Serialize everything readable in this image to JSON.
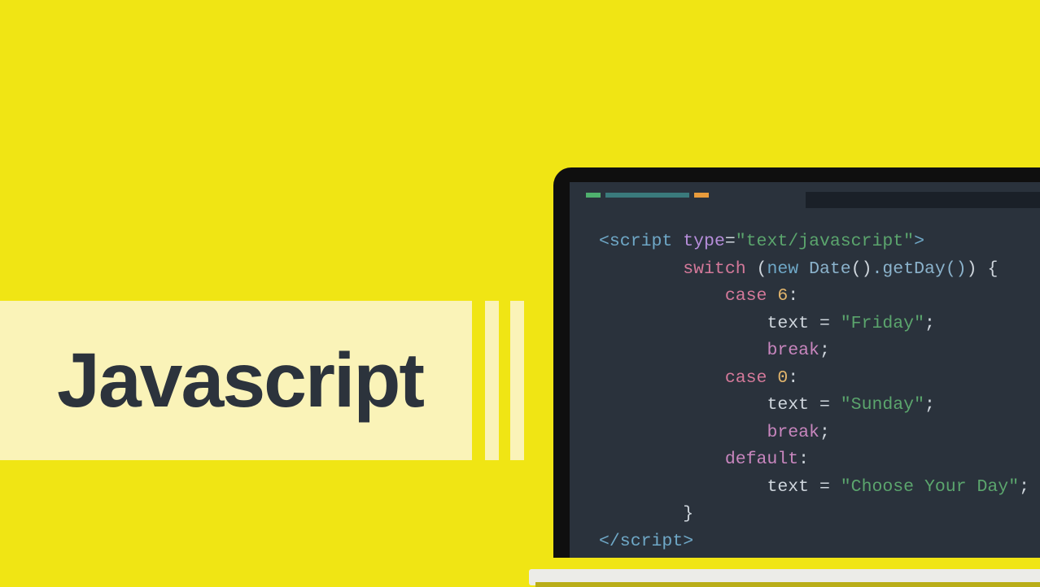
{
  "title": "Javascript",
  "colors": {
    "background": "#f0e514",
    "banner": "#faf3b8",
    "titleText": "#2c333c",
    "screen": "#2a323c",
    "bezel": "#0f0f0f"
  },
  "tabIndicators": [
    {
      "color": "#4fb06e",
      "name": "green"
    },
    {
      "color": "#3a7a7c",
      "name": "teal"
    },
    {
      "color": "#e89b3c",
      "name": "orange"
    }
  ],
  "code": {
    "tagOpen": "<script",
    "attrName": "type",
    "eq": "=",
    "attrValue": "\"text/javascript\"",
    "tagClose": ">",
    "switch": "switch",
    "openParen": "(",
    "new": "new",
    "dateCall": "Date",
    "getDayCall": ".getDay()",
    "closeParen": ") ",
    "openBrace": "{",
    "case": "case",
    "num6": "6",
    "colon": ":",
    "textVar": "text",
    "assign": " = ",
    "friday": "\"Friday\"",
    "semicolon": ";",
    "break": "break",
    "num0": "0",
    "sunday": "\"Sunday\"",
    "default": "default",
    "choose": "\"Choose Your Day\"",
    "closeBrace": "}",
    "scriptClose": "</script",
    "closeAngle": ">"
  }
}
